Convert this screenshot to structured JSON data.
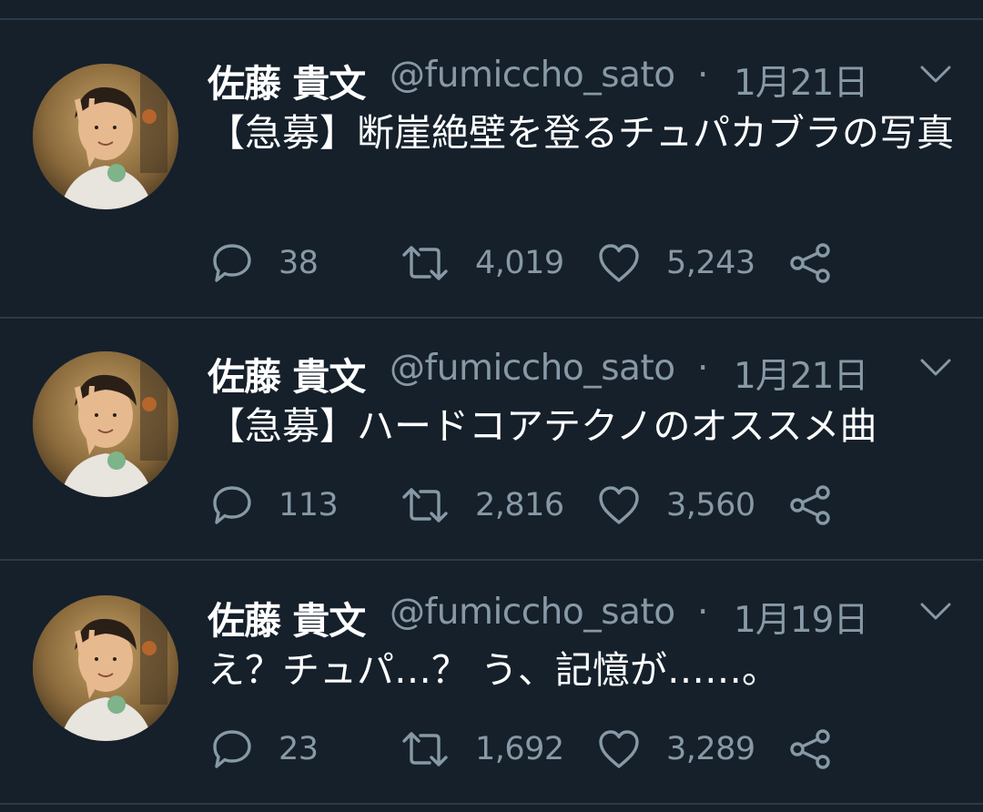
{
  "tweets": [
    {
      "name": "佐藤 貴文",
      "handle": "@fumiccho_sato",
      "separator": "·",
      "date": "1月21日",
      "text": "【急募】断崖絶壁を登るチュパカブラの写真",
      "replies": "38",
      "retweets": "4,019",
      "likes": "5,243"
    },
    {
      "name": "佐藤 貴文",
      "handle": "@fumiccho_sato",
      "separator": "·",
      "date": "1月21日",
      "text": "【急募】ハードコアテクノのオススメ曲",
      "replies": "113",
      "retweets": "2,816",
      "likes": "3,560"
    },
    {
      "name": "佐藤 貴文",
      "handle": "@fumiccho_sato",
      "separator": "·",
      "date": "1月19日",
      "text": "え？チュパ…？ う、記憶が……。",
      "replies": "23",
      "retweets": "1,692",
      "likes": "3,289"
    }
  ],
  "icons": {
    "reply": "speech-bubble-icon",
    "retweet": "retweet-arrows-icon",
    "like": "heart-icon",
    "share": "share-nodes-icon",
    "caret": "chevron-down-icon"
  },
  "colors": {
    "background": "#15202b",
    "divider": "#2b3a48",
    "text_primary": "#ffffff",
    "text_secondary": "#8899a6"
  }
}
